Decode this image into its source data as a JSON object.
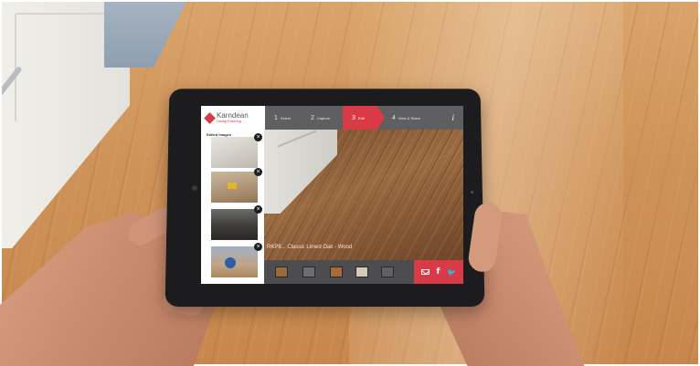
{
  "brand": {
    "name": "Karndean",
    "subtitle": "DesignFlooring"
  },
  "steps": [
    {
      "number": "1",
      "label": "Select",
      "active": false
    },
    {
      "number": "2",
      "label": "Capture",
      "active": false
    },
    {
      "number": "3",
      "label": "Edit",
      "active": true
    },
    {
      "number": "4",
      "label": "View & Share",
      "active": false
    }
  ],
  "info_icon": "i",
  "sidebar": {
    "title": "Edited Images",
    "close_glyph": "×",
    "thumbnails": [
      "thumbnail-1",
      "thumbnail-2",
      "thumbnail-3",
      "thumbnail-4"
    ]
  },
  "floor_name": "RKP8... Classic Limed Oak - Wood",
  "swatches": [
    "#9a6a3f",
    "#6b6e72",
    "#a56b3b",
    "#d8cab8",
    "#5e6064"
  ],
  "share": {
    "icons": [
      "mail-icon",
      "facebook-icon",
      "twitter-icon"
    ],
    "facebook_glyph": "f",
    "twitter_glyph": "🐦"
  },
  "colors": {
    "accent": "#d83a46",
    "header_bg": "#5f5f61",
    "bottom_bg": "#4d4d4f"
  }
}
